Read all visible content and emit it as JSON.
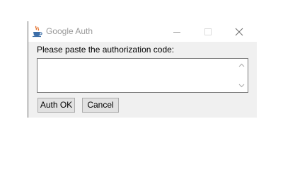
{
  "window": {
    "title": "Google Auth",
    "icon": "java-app-icon"
  },
  "dialog": {
    "prompt": "Please paste the authorization code:",
    "code_value": "",
    "ok_label": "Auth OK",
    "cancel_label": "Cancel"
  },
  "colors": {
    "title_inactive": "#9a9a9a",
    "dialog_bg": "#f0f0f0",
    "button_bg": "#e1e1e1",
    "button_border": "#adadad"
  }
}
